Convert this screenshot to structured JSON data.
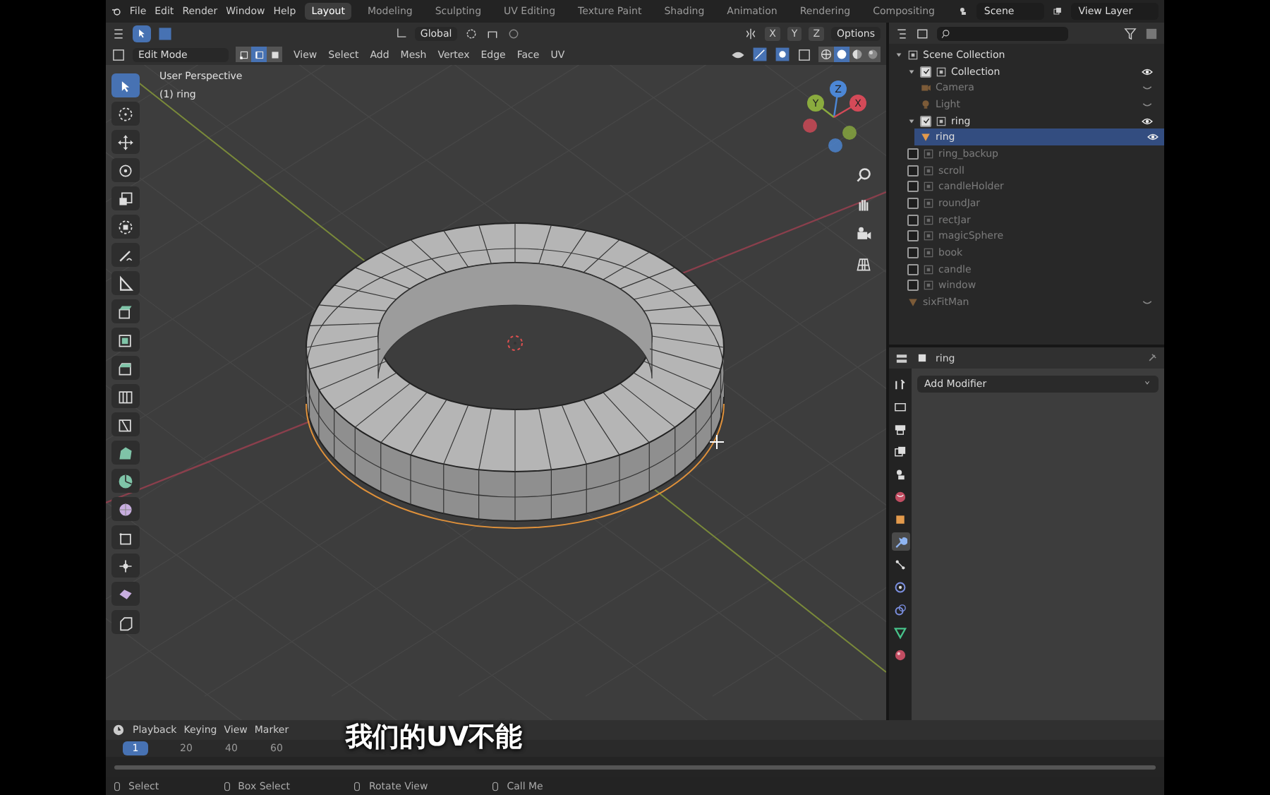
{
  "topbar": {
    "menus": [
      "File",
      "Edit",
      "Render",
      "Window",
      "Help"
    ],
    "workspaces": [
      {
        "label": "Layout",
        "selected": true
      },
      {
        "label": "Modeling",
        "selected": false
      },
      {
        "label": "Sculpting",
        "selected": false
      },
      {
        "label": "UV Editing",
        "selected": false
      },
      {
        "label": "Texture Paint",
        "selected": false
      },
      {
        "label": "Shading",
        "selected": false
      },
      {
        "label": "Animation",
        "selected": false
      },
      {
        "label": "Rendering",
        "selected": false
      },
      {
        "label": "Compositing",
        "selected": false
      }
    ],
    "scene": "Scene",
    "view_layer": "View Layer"
  },
  "tool_settings": {
    "orientation": "Global",
    "axes": [
      "X",
      "Y",
      "Z"
    ],
    "options": "Options"
  },
  "viewport_header": {
    "mode": "Edit Mode",
    "select_modes": [
      {
        "kind": "vertex",
        "selected": false
      },
      {
        "kind": "edge",
        "selected": true
      },
      {
        "kind": "face",
        "selected": false
      }
    ],
    "menus": [
      "View",
      "Select",
      "Add",
      "Mesh",
      "Vertex",
      "Edge",
      "Face",
      "UV"
    ],
    "shading": [
      {
        "kind": "wireframe",
        "selected": false
      },
      {
        "kind": "solid",
        "selected": true
      },
      {
        "kind": "material",
        "selected": false
      },
      {
        "kind": "rendered",
        "selected": false
      }
    ]
  },
  "viewport": {
    "view_name": "User Perspective",
    "object_label": "(1) ring",
    "tools": [
      {
        "kind": "select",
        "selected": true
      },
      {
        "kind": "cursor",
        "selected": false
      },
      {
        "kind": "move",
        "selected": false
      },
      {
        "kind": "rotate",
        "selected": false
      },
      {
        "kind": "scale",
        "selected": false
      },
      {
        "kind": "transform",
        "selected": false
      },
      {
        "kind": "annotate",
        "selected": false
      },
      {
        "kind": "measure",
        "selected": false
      },
      {
        "kind": "extrude",
        "selected": false
      },
      {
        "kind": "inset",
        "selected": false
      },
      {
        "kind": "bevel",
        "selected": false
      },
      {
        "kind": "loopcut",
        "selected": false
      },
      {
        "kind": "knife",
        "selected": false
      },
      {
        "kind": "polybuild",
        "selected": false
      },
      {
        "kind": "spin",
        "selected": false
      },
      {
        "kind": "smooth",
        "selected": false
      },
      {
        "kind": "slide",
        "selected": false
      },
      {
        "kind": "shrink",
        "selected": false
      },
      {
        "kind": "shear",
        "selected": false
      },
      {
        "kind": "rip",
        "selected": false
      }
    ],
    "gizmo": [
      {
        "label": "X",
        "color": "#d44a58"
      },
      {
        "label": "Y",
        "color": "#8aab3e"
      },
      {
        "label": "Z",
        "color": "#4c87d6"
      }
    ]
  },
  "subtitle": "我们的UV不能",
  "outliner": {
    "items": [
      {
        "kind": "scene",
        "name": "Scene Collection",
        "selected": false,
        "children": [
          {
            "kind": "collection",
            "name": "Collection",
            "checked": true,
            "selected": false,
            "children": [
              {
                "kind": "camera",
                "name": "Camera",
                "hidden": true,
                "selected": false
              },
              {
                "kind": "light",
                "name": "Light",
                "hidden": true,
                "selected": false
              }
            ]
          },
          {
            "kind": "collection",
            "name": "ring",
            "checked": true,
            "selected": false,
            "children": [
              {
                "kind": "mesh",
                "name": "ring",
                "hidden": false,
                "selected": true
              }
            ]
          },
          {
            "kind": "collection",
            "name": "ring_backup",
            "checked": false,
            "selected": false
          },
          {
            "kind": "collection",
            "name": "scroll",
            "checked": false,
            "selected": false
          },
          {
            "kind": "collection",
            "name": "candleHolder",
            "checked": false,
            "selected": false
          },
          {
            "kind": "collection",
            "name": "roundJar",
            "checked": false,
            "selected": false
          },
          {
            "kind": "collection",
            "name": "rectJar",
            "checked": false,
            "selected": false
          },
          {
            "kind": "collection",
            "name": "magicSphere",
            "checked": false,
            "selected": false
          },
          {
            "kind": "collection",
            "name": "book",
            "checked": false,
            "selected": false
          },
          {
            "kind": "collection",
            "name": "candle",
            "checked": false,
            "selected": false
          },
          {
            "kind": "collection",
            "name": "window",
            "checked": false,
            "selected": false
          },
          {
            "kind": "mesh",
            "name": "sixFitMan",
            "hidden": true,
            "selected": false
          }
        ]
      }
    ]
  },
  "properties": {
    "object_name": "ring",
    "add_modifier": "Add Modifier",
    "tabs": [
      {
        "kind": "tool",
        "selected": false
      },
      {
        "kind": "render",
        "selected": false
      },
      {
        "kind": "output",
        "selected": false
      },
      {
        "kind": "view_layer",
        "selected": false
      },
      {
        "kind": "scene",
        "selected": false
      },
      {
        "kind": "world",
        "selected": false
      },
      {
        "kind": "object",
        "selected": false
      },
      {
        "kind": "modifier",
        "selected": true
      },
      {
        "kind": "particles",
        "selected": false
      },
      {
        "kind": "physics",
        "selected": false
      },
      {
        "kind": "constraints",
        "selected": false
      },
      {
        "kind": "data",
        "selected": false
      },
      {
        "kind": "material",
        "selected": false
      }
    ]
  },
  "timeline": {
    "menus": [
      "Playback",
      "Keying",
      "View",
      "Marker"
    ],
    "frames": [
      {
        "label": "1",
        "selected": true
      },
      {
        "label": "20",
        "selected": false
      },
      {
        "label": "40",
        "selected": false
      },
      {
        "label": "60",
        "selected": false
      }
    ]
  },
  "status_bar": [
    "Select",
    "Box Select",
    "Rotate View",
    "Call Me"
  ]
}
